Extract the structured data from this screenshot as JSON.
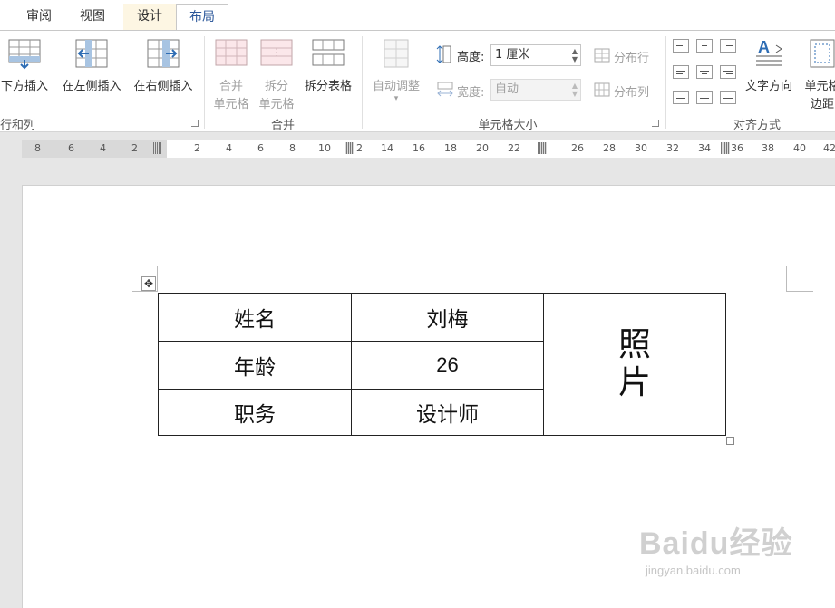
{
  "tabs": [
    {
      "label": "审阅"
    },
    {
      "label": "视图"
    },
    {
      "label": "设计"
    },
    {
      "label": "布局"
    }
  ],
  "ribbon": {
    "rows_cols": {
      "insert_below": "下方插入",
      "insert_left": "在左侧插入",
      "insert_right": "在右侧插入",
      "group_label": "行和列"
    },
    "merge": {
      "merge_cells_1": "合并",
      "merge_cells_2": "单元格",
      "split_cells_1": "拆分",
      "split_cells_2": "单元格",
      "split_table": "拆分表格",
      "group_label": "合并"
    },
    "cell_size": {
      "autofit": "自动调整",
      "height_label": "高度:",
      "height_value": "1 厘米",
      "width_label": "宽度:",
      "width_value": "自动",
      "distribute_rows": "分布行",
      "distribute_cols": "分布列",
      "group_label": "单元格大小"
    },
    "alignment": {
      "text_direction": "文字方向",
      "cell_margins_1": "单元格",
      "cell_margins_2": "边距",
      "group_label": "对齐方式"
    }
  },
  "ruler": {
    "left_numbers": [
      "8",
      "6",
      "4",
      "2"
    ],
    "right_numbers": [
      "2",
      "4",
      "6",
      "8",
      "10",
      "2",
      "14",
      "16",
      "18",
      "20",
      "22",
      "26",
      "28",
      "30",
      "32",
      "34",
      "36",
      "38",
      "40",
      "42"
    ]
  },
  "table": {
    "name_label": "姓名",
    "name_value": "刘梅",
    "age_label": "年龄",
    "age_value": "26",
    "job_label": "职务",
    "job_value": "设计师",
    "photo_line1": "照",
    "photo_line2": "片"
  },
  "watermark": {
    "brand": "Baidu经验",
    "url": "jingyan.baidu.com"
  }
}
